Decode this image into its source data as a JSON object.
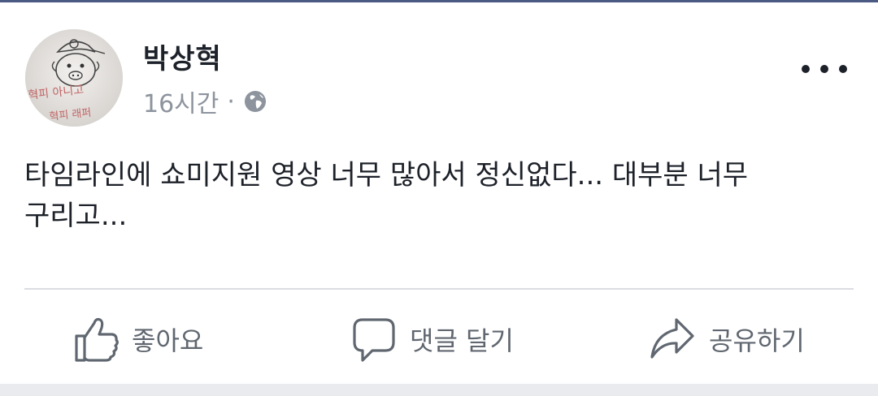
{
  "post": {
    "author": "박상혁",
    "time": "16시간",
    "separator": "·",
    "privacy_icon": "globe-icon",
    "menu_icon": "more-dots-icon",
    "text": "타임라인에 쇼미지원 영상 너무 많아서 정신없다... 대부분 너무 구리고...",
    "avatar_sketch_text": [
      "혁피 아니고",
      "혁피 래퍼"
    ]
  },
  "actions": {
    "like": {
      "label": "좋아요",
      "icon": "thumbs-up-icon"
    },
    "comment": {
      "label": "댓글 달기",
      "icon": "comment-bubble-icon"
    },
    "share": {
      "label": "공유하기",
      "icon": "share-arrow-icon"
    }
  },
  "colors": {
    "text_primary": "#1d2129",
    "text_secondary": "#8d949e",
    "action_text": "#606770",
    "divider": "#dadde1",
    "top_bar": "#4b5a82",
    "page_bg": "#e9ebee"
  }
}
